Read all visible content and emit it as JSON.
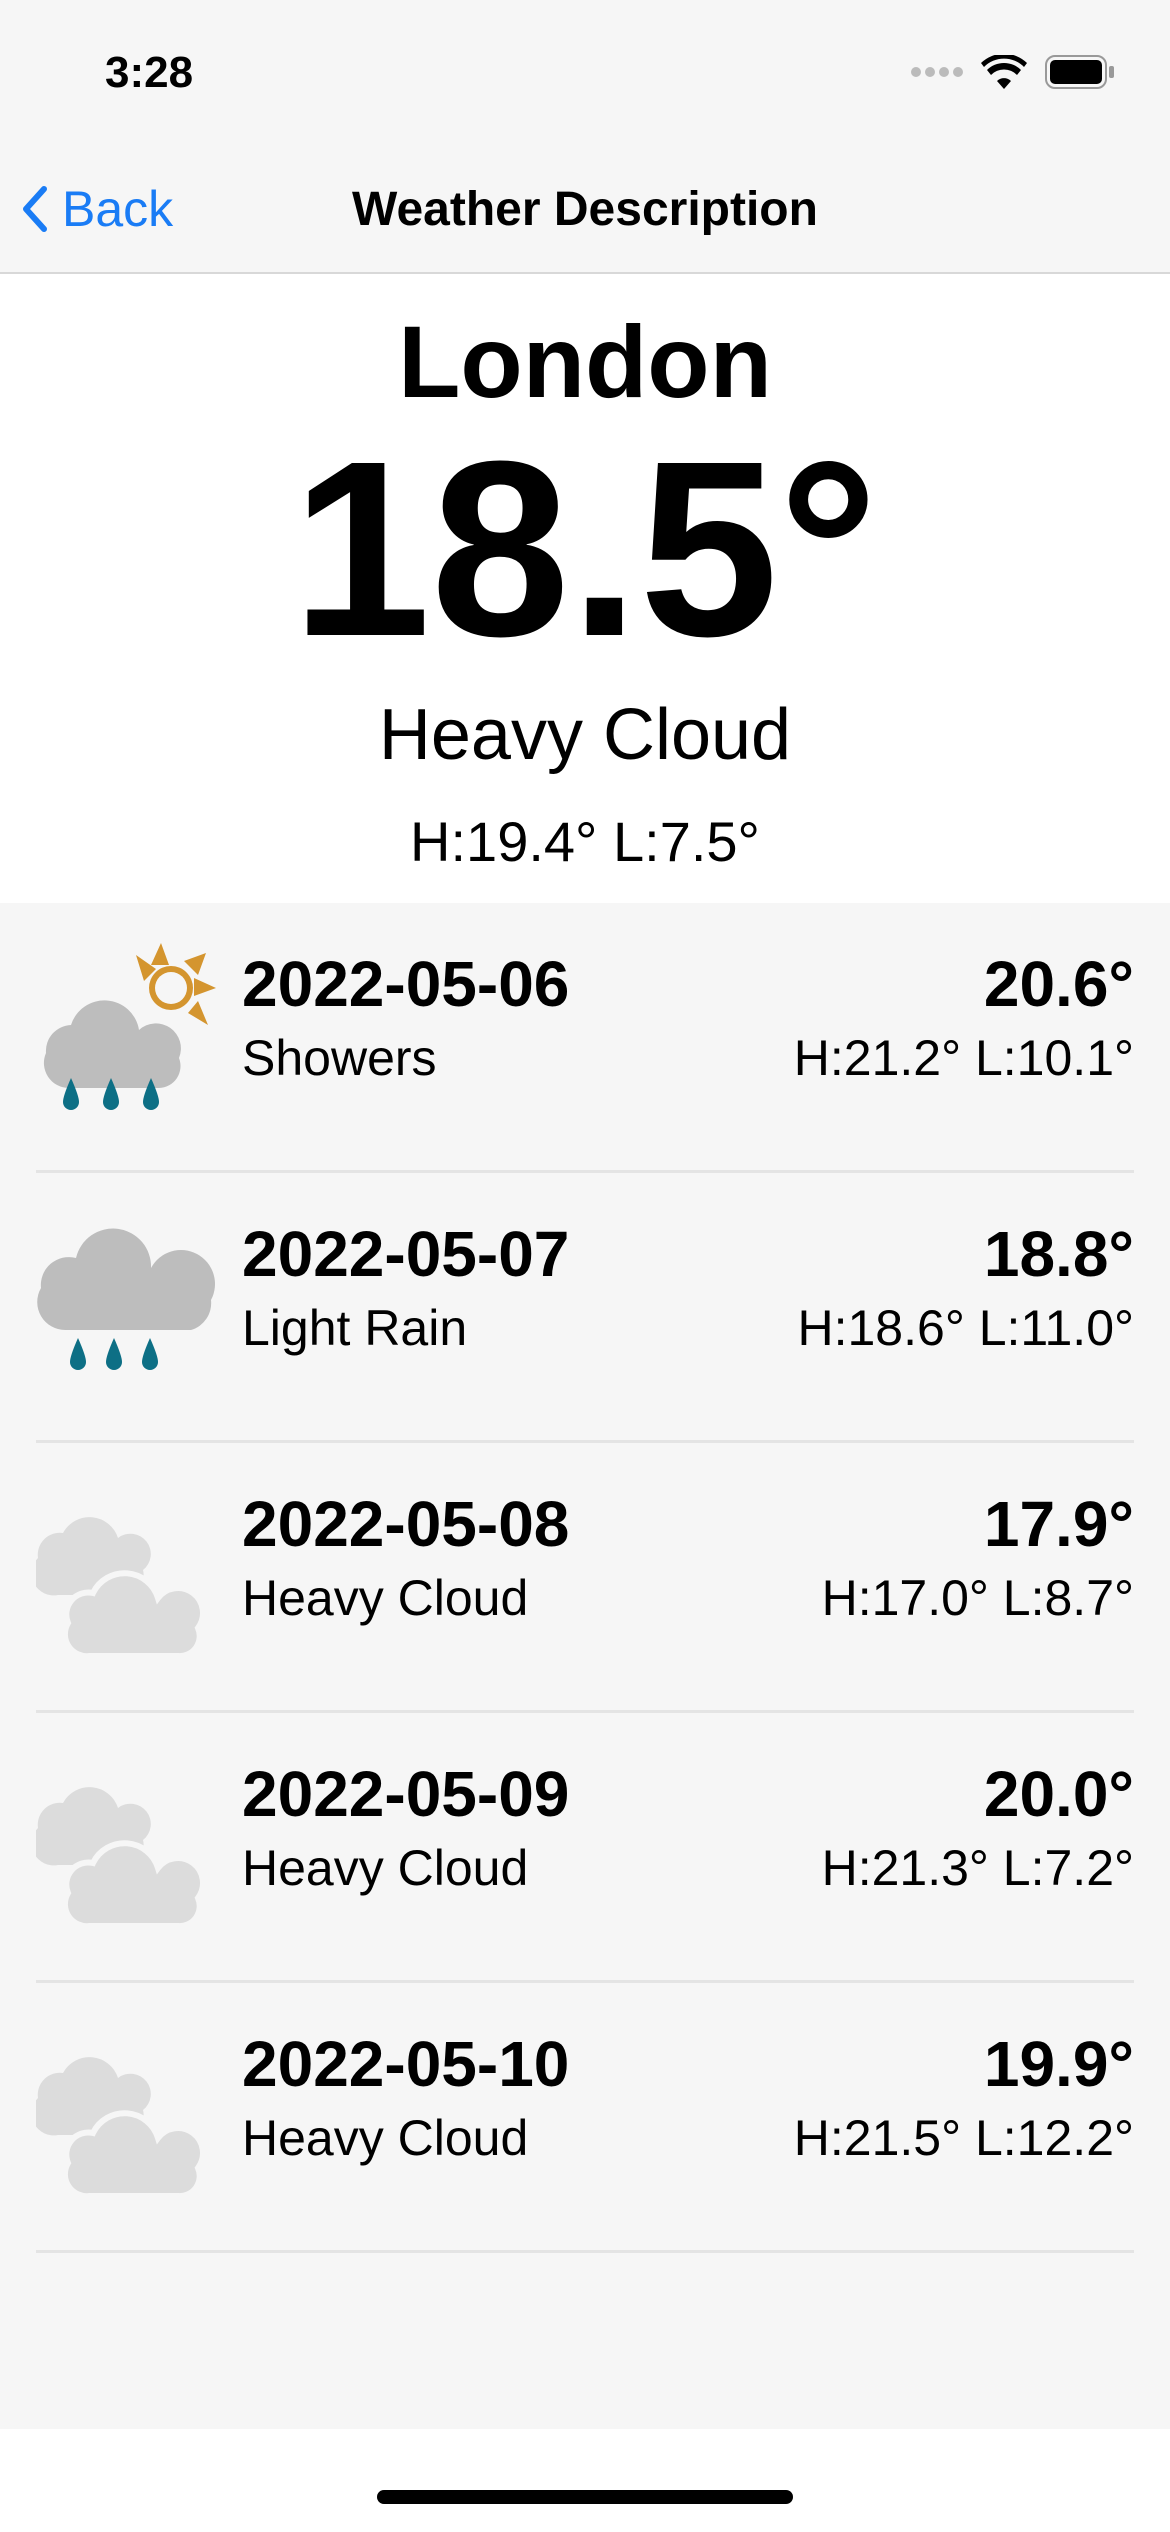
{
  "status_bar": {
    "time": "3:28"
  },
  "nav": {
    "back_label": "Back",
    "title": "Weather Description"
  },
  "current": {
    "city": "London",
    "temperature": "18.5°",
    "condition": "Heavy Cloud",
    "high_low": "H:19.4° L:7.5°"
  },
  "forecast": [
    {
      "date": "2022-05-06",
      "condition": "Showers",
      "temp": "20.6°",
      "high_low": "H:21.2° L:10.1°",
      "icon": "showers-icon"
    },
    {
      "date": "2022-05-07",
      "condition": "Light Rain",
      "temp": "18.8°",
      "high_low": "H:18.6° L:11.0°",
      "icon": "light-rain-icon"
    },
    {
      "date": "2022-05-08",
      "condition": "Heavy Cloud",
      "temp": "17.9°",
      "high_low": "H:17.0° L:8.7°",
      "icon": "heavy-cloud-icon"
    },
    {
      "date": "2022-05-09",
      "condition": "Heavy Cloud",
      "temp": "20.0°",
      "high_low": "H:21.3° L:7.2°",
      "icon": "heavy-cloud-icon"
    },
    {
      "date": "2022-05-10",
      "condition": "Heavy Cloud",
      "temp": "19.9°",
      "high_low": "H:21.5° L:12.2°",
      "icon": "heavy-cloud-icon"
    }
  ],
  "colors": {
    "accent": "#1a7cf5",
    "sun": "#d4952f",
    "rain": "#0d6f85",
    "cloud": "#bdbdbd",
    "light_cloud": "#dcdcdc"
  }
}
